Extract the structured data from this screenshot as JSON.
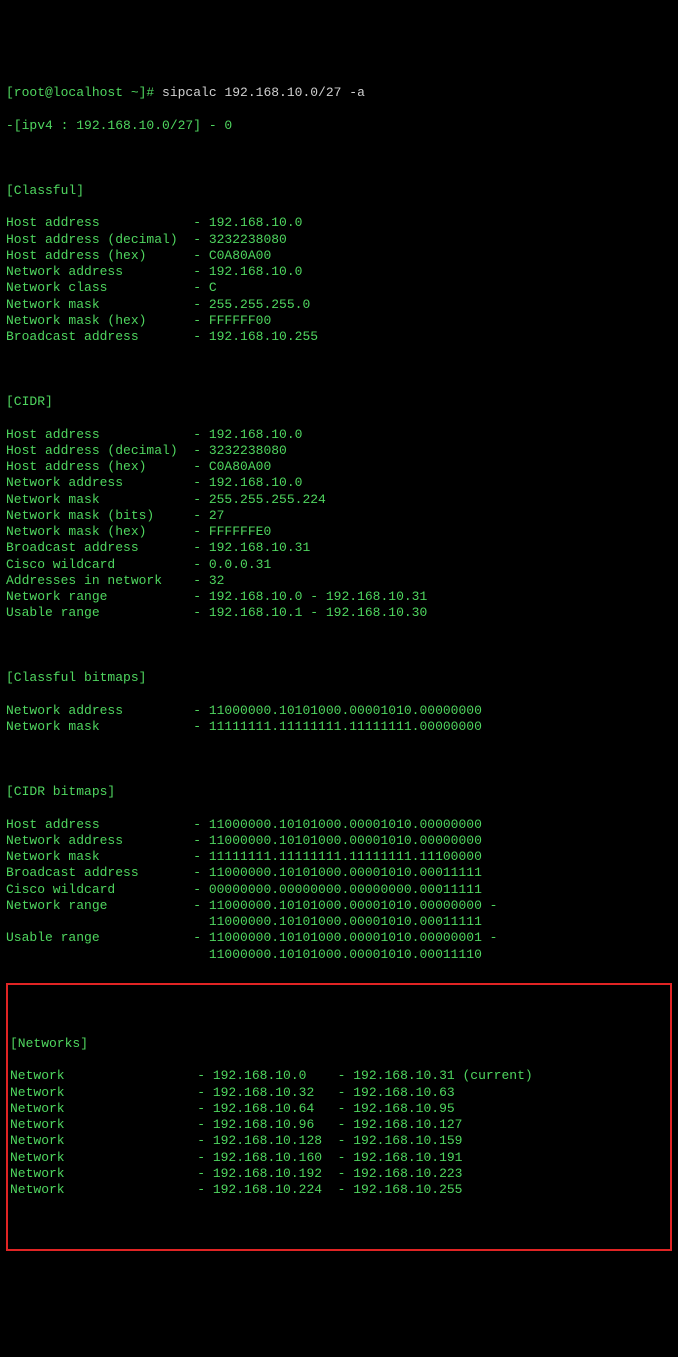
{
  "prompt": {
    "user_host": "[root@localhost ~]# ",
    "command": "sipcalc 192.168.10.0/27 -a"
  },
  "header_line": "-[ipv4 : 192.168.10.0/27] - 0",
  "classful": {
    "title": "[Classful]",
    "rows": [
      {
        "label": "Host address",
        "value": "192.168.10.0"
      },
      {
        "label": "Host address (decimal)",
        "value": "3232238080"
      },
      {
        "label": "Host address (hex)",
        "value": "C0A80A00"
      },
      {
        "label": "Network address",
        "value": "192.168.10.0"
      },
      {
        "label": "Network class",
        "value": "C"
      },
      {
        "label": "Network mask",
        "value": "255.255.255.0"
      },
      {
        "label": "Network mask (hex)",
        "value": "FFFFFF00"
      },
      {
        "label": "Broadcast address",
        "value": "192.168.10.255"
      }
    ]
  },
  "cidr": {
    "title": "[CIDR]",
    "rows": [
      {
        "label": "Host address",
        "value": "192.168.10.0"
      },
      {
        "label": "Host address (decimal)",
        "value": "3232238080"
      },
      {
        "label": "Host address (hex)",
        "value": "C0A80A00"
      },
      {
        "label": "Network address",
        "value": "192.168.10.0"
      },
      {
        "label": "Network mask",
        "value": "255.255.255.224"
      },
      {
        "label": "Network mask (bits)",
        "value": "27"
      },
      {
        "label": "Network mask (hex)",
        "value": "FFFFFFE0"
      },
      {
        "label": "Broadcast address",
        "value": "192.168.10.31"
      },
      {
        "label": "Cisco wildcard",
        "value": "0.0.0.31"
      },
      {
        "label": "Addresses in network",
        "value": "32"
      },
      {
        "label": "Network range",
        "value": "192.168.10.0 - 192.168.10.31"
      },
      {
        "label": "Usable range",
        "value": "192.168.10.1 - 192.168.10.30"
      }
    ]
  },
  "classful_bitmaps": {
    "title": "[Classful bitmaps]",
    "rows": [
      {
        "label": "Network address",
        "value": "11000000.10101000.00001010.00000000"
      },
      {
        "label": "Network mask",
        "value": "11111111.11111111.11111111.00000000"
      }
    ]
  },
  "cidr_bitmaps": {
    "title": "[CIDR bitmaps]",
    "rows": [
      {
        "label": "Host address",
        "value": "11000000.10101000.00001010.00000000"
      },
      {
        "label": "Network address",
        "value": "11000000.10101000.00001010.00000000"
      },
      {
        "label": "Network mask",
        "value": "11111111.11111111.11111111.11100000"
      },
      {
        "label": "Broadcast address",
        "value": "11000000.10101000.00001010.00011111"
      },
      {
        "label": "Cisco wildcard",
        "value": "00000000.00000000.00000000.00011111"
      },
      {
        "label": "Network range",
        "value": "11000000.10101000.00001010.00000000 -"
      },
      {
        "label": "",
        "value": "11000000.10101000.00001010.00011111"
      },
      {
        "label": "Usable range",
        "value": "11000000.10101000.00001010.00000001 -"
      },
      {
        "label": "",
        "value": "11000000.10101000.00001010.00011110"
      }
    ]
  },
  "networks": {
    "title": "[Networks]",
    "rows": [
      {
        "label": "Network",
        "start": "192.168.10.0",
        "end": "192.168.10.31 (current)"
      },
      {
        "label": "Network",
        "start": "192.168.10.32",
        "end": "192.168.10.63"
      },
      {
        "label": "Network",
        "start": "192.168.10.64",
        "end": "192.168.10.95"
      },
      {
        "label": "Network",
        "start": "192.168.10.96",
        "end": "192.168.10.127"
      },
      {
        "label": "Network",
        "start": "192.168.10.128",
        "end": "192.168.10.159"
      },
      {
        "label": "Network",
        "start": "192.168.10.160",
        "end": "192.168.10.191"
      },
      {
        "label": "Network",
        "start": "192.168.10.192",
        "end": "192.168.10.223"
      },
      {
        "label": "Network",
        "start": "192.168.10.224",
        "end": "192.168.10.255"
      }
    ]
  }
}
